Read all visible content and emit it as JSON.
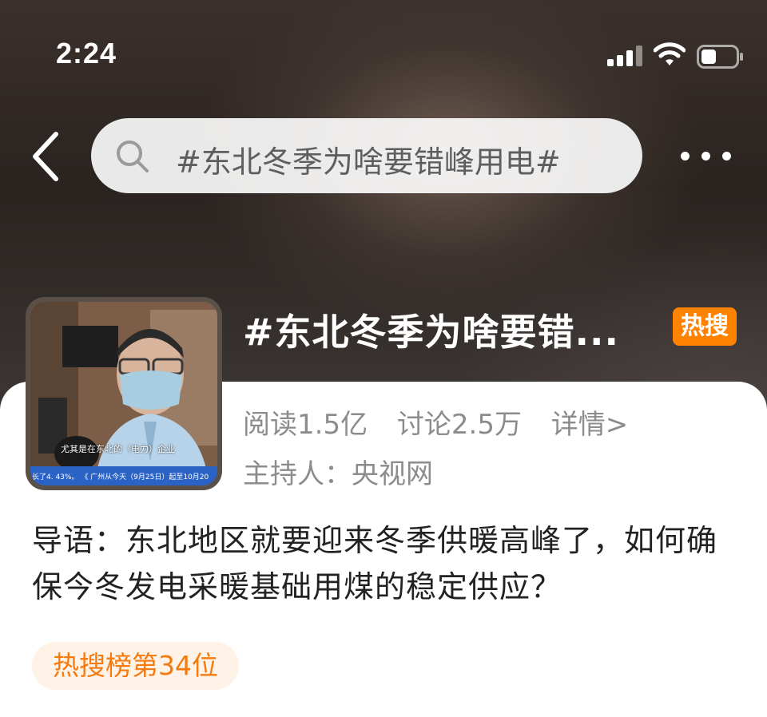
{
  "status_bar": {
    "time": "2:24"
  },
  "search": {
    "query": "#东北冬季为啥要错峰用电#"
  },
  "topic": {
    "title": "#东北冬季为啥要错...",
    "hot_badge": "热搜",
    "reads": "阅读1.5亿",
    "discussions": "讨论2.5万",
    "detail_link": "详情>",
    "host": "主持人：央视网",
    "thumbnail_caption": "尤其是在东北的（电力）企业",
    "thumbnail_ticker": "长了4. 43%。  《 广州从今天（9月25日）起至10月20"
  },
  "intro": {
    "text": "导语：东北地区就要迎来冬季供暖高峰了，如何确保今冬发电采暖基础用煤的稳定供应？"
  },
  "rank_tag": {
    "label": "热搜榜第34位"
  },
  "icons": {
    "back": "chevron-left-icon",
    "search": "search-icon",
    "more": "more-dots-icon",
    "signal": "cellular-signal-icon",
    "wifi": "wifi-icon",
    "battery": "battery-icon"
  },
  "colors": {
    "hot_badge": "#ff8200",
    "rank_tag_bg": "#fff2e6",
    "rank_tag_text": "#f57a10",
    "secondary_text": "#8c8c8c"
  }
}
